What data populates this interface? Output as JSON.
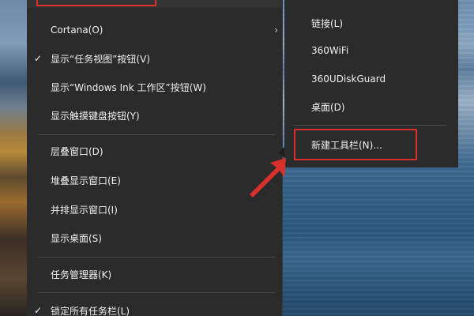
{
  "main_menu": {
    "items": [
      {
        "label": "Cortana(O)",
        "checked": false,
        "has_submenu": true
      },
      {
        "label": "显示“任务视图”按钮(V)",
        "checked": true,
        "has_submenu": false
      },
      {
        "label": "显示“Windows Ink 工作区”按钮(W)",
        "checked": false,
        "has_submenu": false
      },
      {
        "label": "显示触摸键盘按钮(Y)",
        "checked": false,
        "has_submenu": false
      },
      {
        "label": "层叠窗口(D)",
        "checked": false,
        "has_submenu": false
      },
      {
        "label": "堆叠显示窗口(E)",
        "checked": false,
        "has_submenu": false
      },
      {
        "label": "并排显示窗口(I)",
        "checked": false,
        "has_submenu": false
      },
      {
        "label": "显示桌面(S)",
        "checked": false,
        "has_submenu": false
      },
      {
        "label": "任务管理器(K)",
        "checked": false,
        "has_submenu": false
      },
      {
        "label": "锁定所有任务栏(L)",
        "checked": true,
        "has_submenu": false
      }
    ],
    "check_glyph": "✓",
    "chevron_glyph": "›"
  },
  "toolbars_submenu": {
    "items": [
      {
        "label": "链接(L)"
      },
      {
        "label": "360WiFi"
      },
      {
        "label": "360UDiskGuard"
      },
      {
        "label": "桌面(D)"
      },
      {
        "label": "新建工具栏(N)..."
      }
    ]
  },
  "colors": {
    "menu_bg": "#2b2b2b",
    "text": "#f0f0f0",
    "separator": "#4a4a4a",
    "annotation_red": "#d9302b"
  }
}
